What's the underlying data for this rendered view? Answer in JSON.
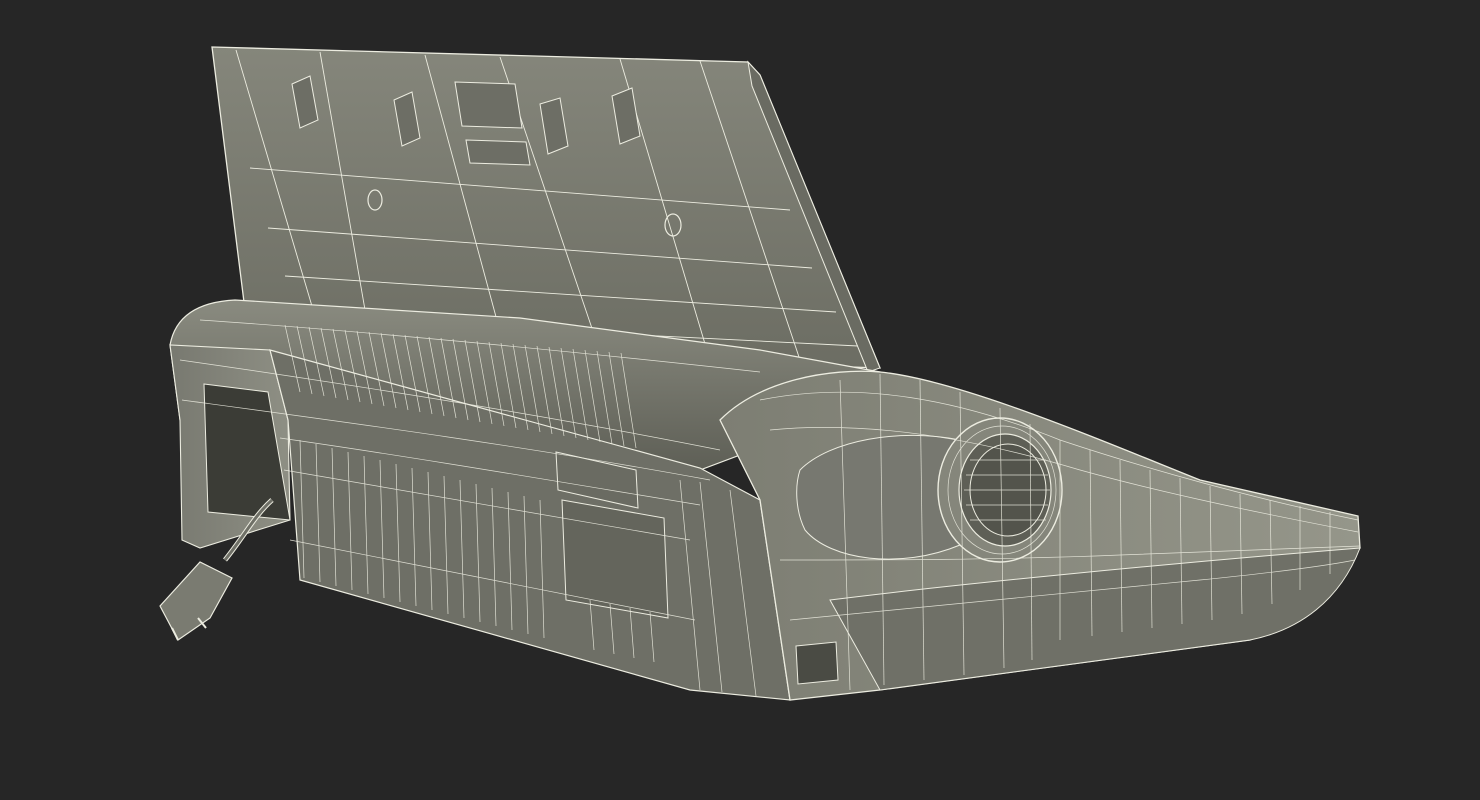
{
  "scene": {
    "background_color": "#262626",
    "model_fill_color": "#7c7d72",
    "model_shade_color": "#5f6057",
    "model_dark_color": "#3d3e38",
    "wire_color": "#ecece0"
  }
}
